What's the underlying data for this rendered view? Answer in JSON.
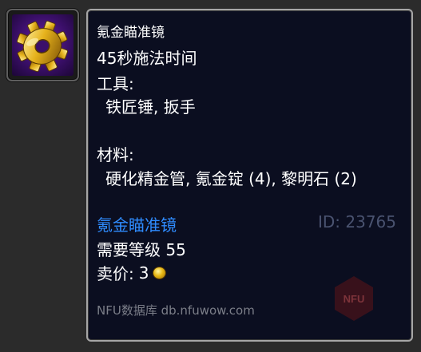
{
  "item_icon": {
    "icon": "gear-icon",
    "colors": {
      "background": "#3b0f6a",
      "gear": "#e8b814"
    }
  },
  "tooltip": {
    "title": "氪金瞄准镜",
    "cast_time": "45秒施法时间",
    "tools_label": "工具:",
    "tools_value": "铁匠锤, 扳手",
    "materials_label": "材料:",
    "materials_value": "硬化精金管, 氪金锭 (4), 黎明石 (2)",
    "item_link": "氪金瞄准镜",
    "item_id": "ID: 23765",
    "required_level": "需要等级 55",
    "sell_price_label": "卖价:",
    "sell_price_value": "3",
    "sell_price_icon": "gold-coin-icon",
    "footer": "NFU数据库 db.nfuwow.com",
    "watermark": "NFU",
    "colors": {
      "background": "#0b0e20",
      "border": "#a6a6a6",
      "text": "#ffffff",
      "link": "#2f8cff",
      "muted": "#4a5370"
    }
  }
}
